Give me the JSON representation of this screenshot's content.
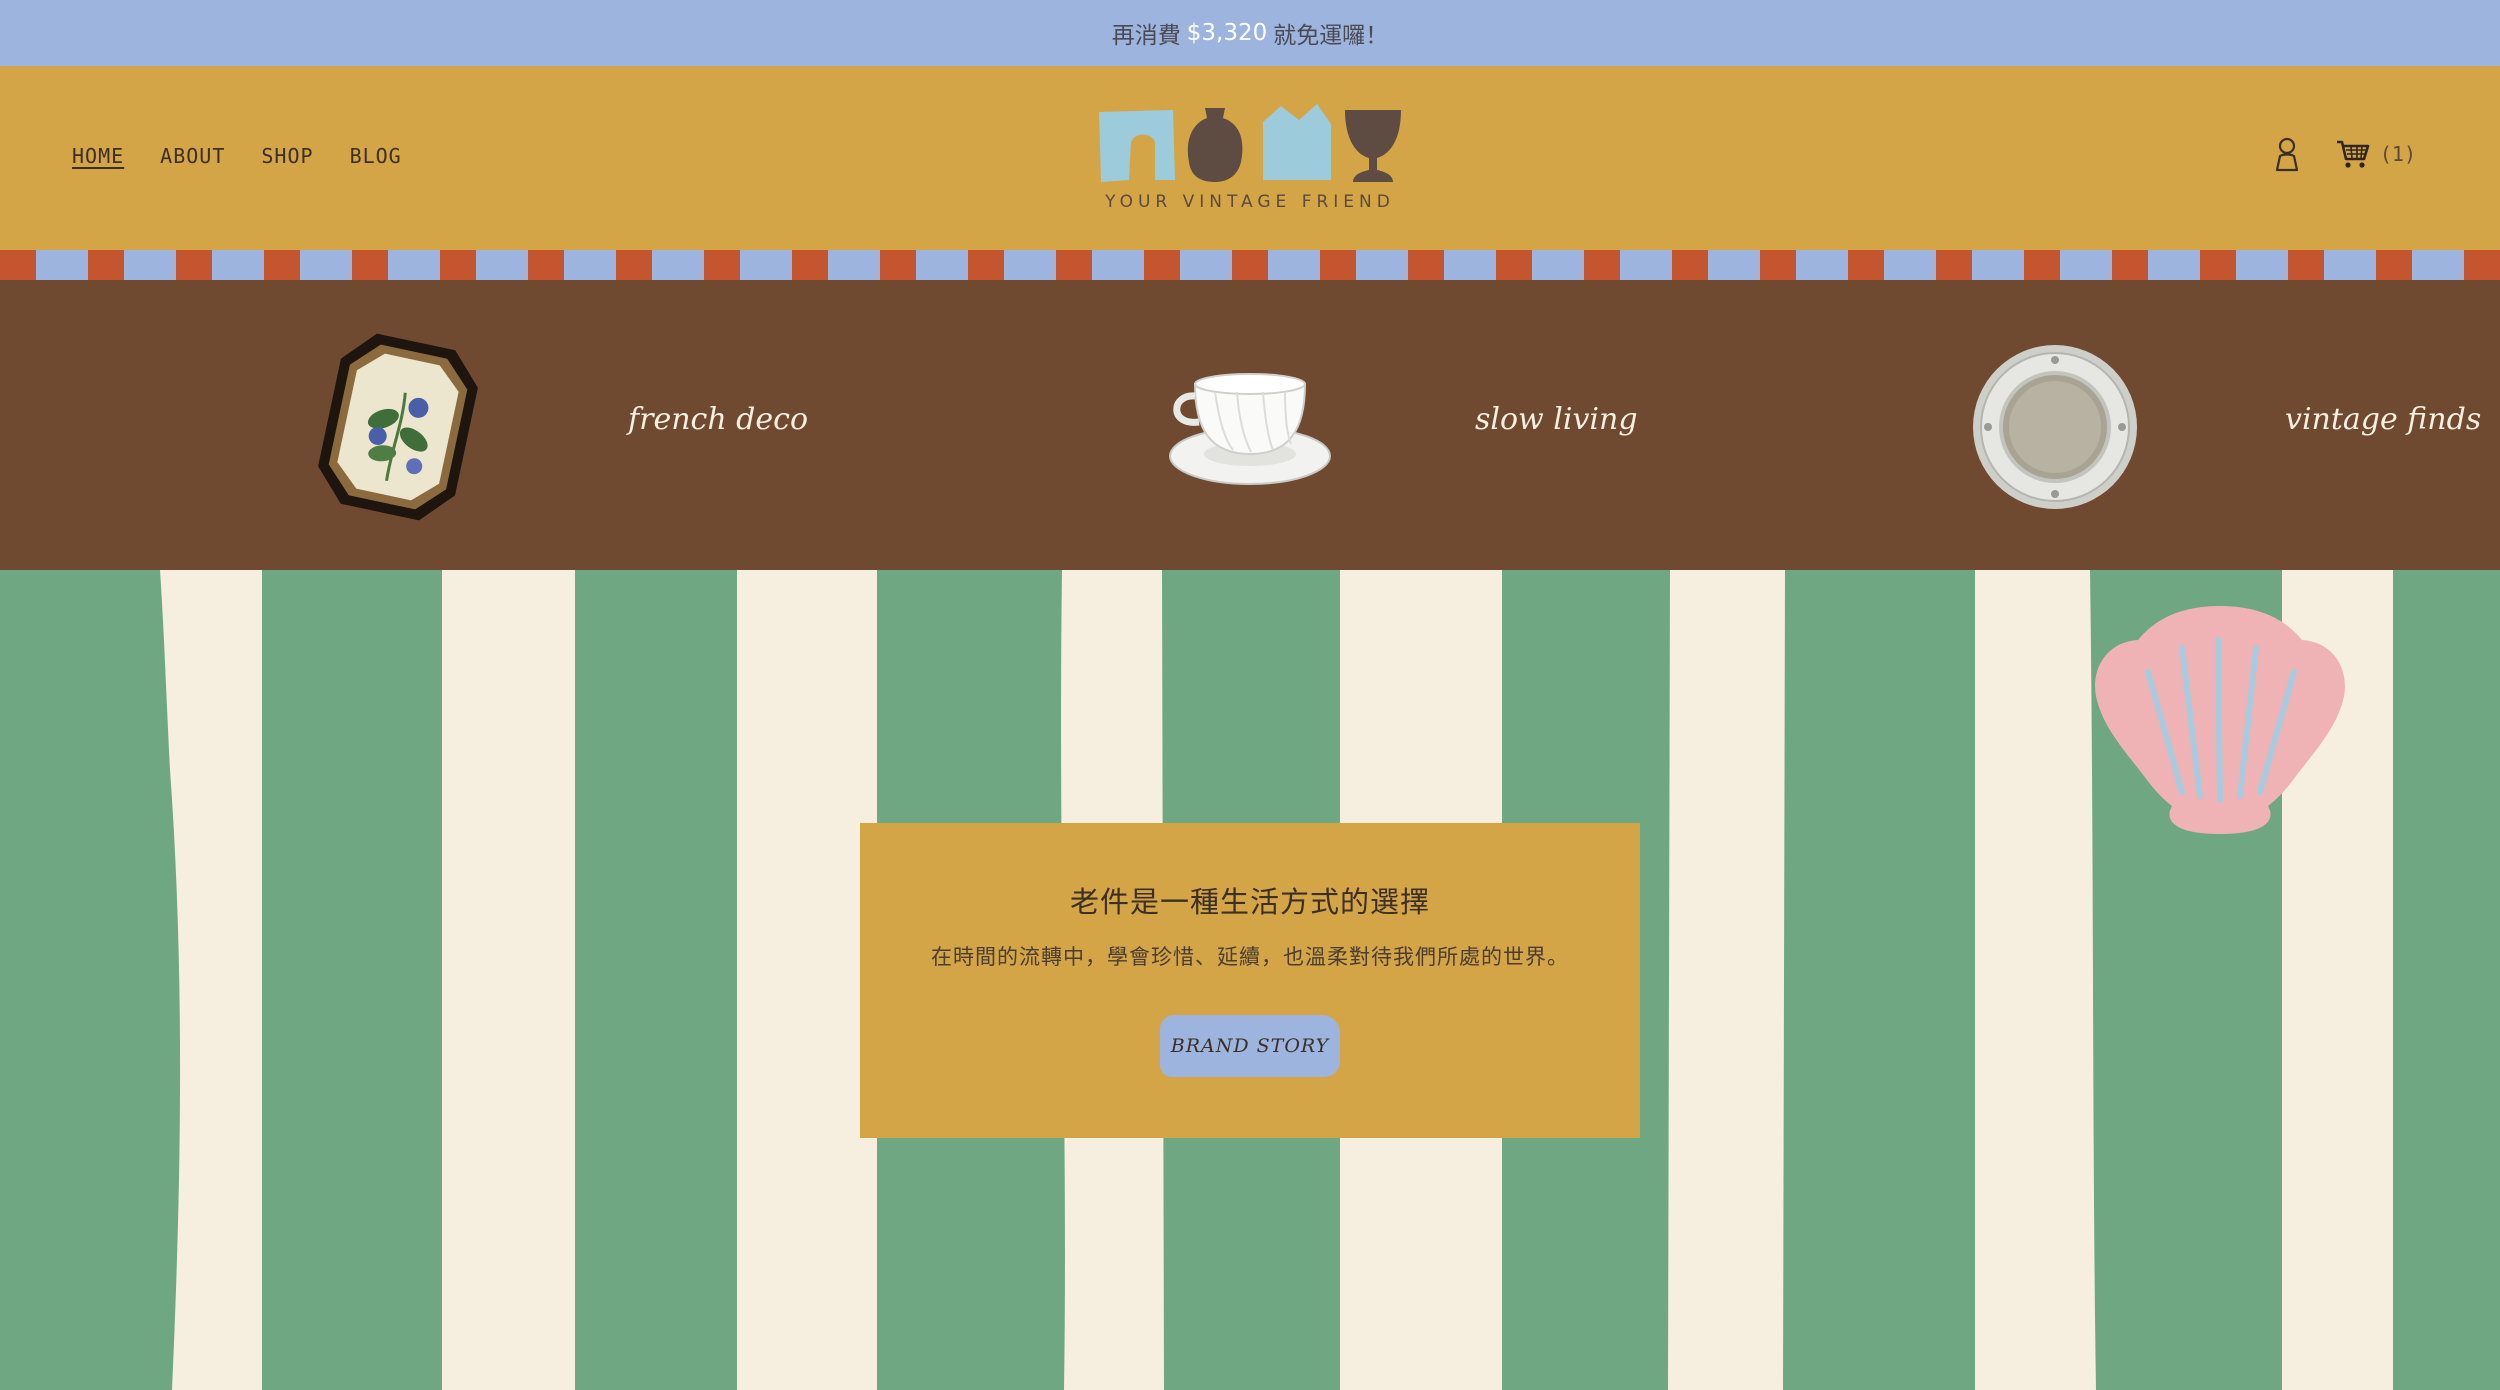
{
  "announcement": {
    "prefix": "再消費",
    "amount": "$3,320",
    "suffix": "就免運囉！"
  },
  "nav": {
    "items": [
      {
        "label": "HOME",
        "active": true
      },
      {
        "label": "ABOUT",
        "active": false
      },
      {
        "label": "SHOP",
        "active": false
      },
      {
        "label": "BLOG",
        "active": false
      }
    ]
  },
  "logo": {
    "tagline": "YOUR VINTAGE FRIEND"
  },
  "header": {
    "cart_count": "(1)",
    "account_icon": "user-icon",
    "cart_icon": "cart-icon"
  },
  "categories": [
    {
      "label": "french deco",
      "image": "framed-botanical-print"
    },
    {
      "label": "slow living",
      "image": "teacup-saucer"
    },
    {
      "label": "vintage finds",
      "image": "silver-tray"
    }
  ],
  "hero": {
    "title": "老件是一種生活方式的選擇",
    "subtitle": "在時間的流轉中，學會珍惜、延續，也溫柔對待我們所處的世界。",
    "button_label": "BRAND STORY",
    "decoration": "seashell"
  },
  "colors": {
    "announce_bg": "#9db4df",
    "header_bg": "#d4a546",
    "stripe_red": "#c4552f",
    "category_bg": "#6f4a30",
    "hero_green": "#6fa783",
    "hero_cream": "#f6efe0",
    "shell_pink": "#f0b3b5"
  }
}
